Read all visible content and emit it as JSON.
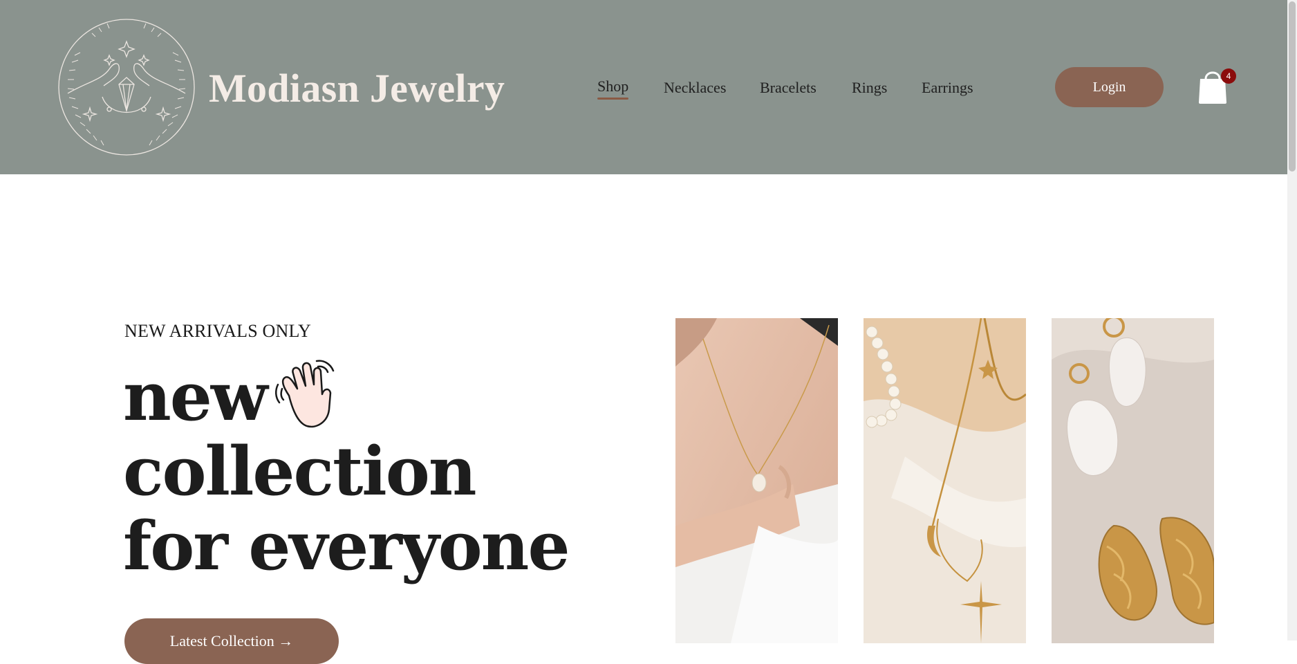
{
  "header": {
    "brand": "Modiasn Jewelry",
    "nav": [
      {
        "label": "Shop",
        "active": true
      },
      {
        "label": "Necklaces",
        "active": false
      },
      {
        "label": "Bracelets",
        "active": false
      },
      {
        "label": "Rings",
        "active": false
      },
      {
        "label": "Earrings",
        "active": false
      }
    ],
    "login_label": "Login",
    "cart_icon": "shopping-bag-icon",
    "cart_count": "4"
  },
  "hero": {
    "eyebrow": "NEW ARRIVALS ONLY",
    "headline_line1": "new",
    "headline_line2": "collection",
    "headline_line3": "for everyone",
    "emoji_icon": "waving-hand-icon",
    "cta_label": "Latest Collection →"
  },
  "gallery": [
    {
      "subject": "pearl pendant necklace"
    },
    {
      "subject": "gold charm necklaces with pearls"
    },
    {
      "subject": "pearl and gold hoop earrings"
    }
  ],
  "colors": {
    "header_bg": "#8a938e",
    "accent_brown": "#8a6453",
    "badge": "#8b0c0c",
    "brand_text": "#f4ece6"
  }
}
